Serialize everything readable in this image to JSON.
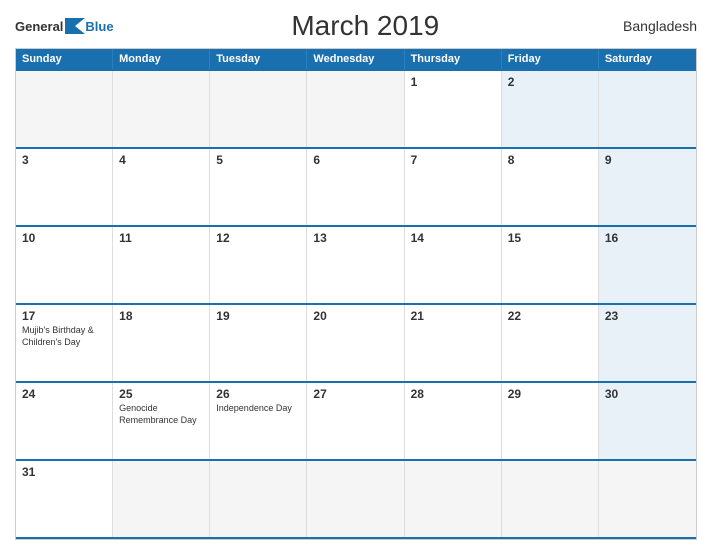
{
  "header": {
    "logo_general": "General",
    "logo_blue": "Blue",
    "title": "March 2019",
    "country": "Bangladesh"
  },
  "calendar": {
    "days_of_week": [
      "Sunday",
      "Monday",
      "Tuesday",
      "Wednesday",
      "Thursday",
      "Friday",
      "Saturday"
    ],
    "weeks": [
      [
        {
          "day": "",
          "empty": true
        },
        {
          "day": "",
          "empty": true
        },
        {
          "day": "",
          "empty": true
        },
        {
          "day": "",
          "empty": true
        },
        {
          "day": "1",
          "event": ""
        },
        {
          "day": "2",
          "event": "",
          "saturday": true
        },
        {
          "day": "",
          "empty": true,
          "hidden": true
        }
      ],
      [
        {
          "day": "3",
          "event": ""
        },
        {
          "day": "4",
          "event": ""
        },
        {
          "day": "5",
          "event": ""
        },
        {
          "day": "6",
          "event": ""
        },
        {
          "day": "7",
          "event": ""
        },
        {
          "day": "8",
          "event": ""
        },
        {
          "day": "9",
          "event": "",
          "saturday": true
        }
      ],
      [
        {
          "day": "10",
          "event": ""
        },
        {
          "day": "11",
          "event": ""
        },
        {
          "day": "12",
          "event": ""
        },
        {
          "day": "13",
          "event": ""
        },
        {
          "day": "14",
          "event": ""
        },
        {
          "day": "15",
          "event": ""
        },
        {
          "day": "16",
          "event": "",
          "saturday": true
        }
      ],
      [
        {
          "day": "17",
          "event": "Mujib's Birthday &\nChildren's Day"
        },
        {
          "day": "18",
          "event": ""
        },
        {
          "day": "19",
          "event": ""
        },
        {
          "day": "20",
          "event": ""
        },
        {
          "day": "21",
          "event": ""
        },
        {
          "day": "22",
          "event": ""
        },
        {
          "day": "23",
          "event": "",
          "saturday": true
        }
      ],
      [
        {
          "day": "24",
          "event": ""
        },
        {
          "day": "25",
          "event": "Genocide\nRemembrance Day"
        },
        {
          "day": "26",
          "event": "Independence Day"
        },
        {
          "day": "27",
          "event": ""
        },
        {
          "day": "28",
          "event": ""
        },
        {
          "day": "29",
          "event": ""
        },
        {
          "day": "30",
          "event": "",
          "saturday": true
        }
      ],
      [
        {
          "day": "31",
          "event": ""
        },
        {
          "day": "",
          "empty": true
        },
        {
          "day": "",
          "empty": true
        },
        {
          "day": "",
          "empty": true
        },
        {
          "day": "",
          "empty": true
        },
        {
          "day": "",
          "empty": true
        },
        {
          "day": "",
          "empty": true,
          "saturday": true
        }
      ]
    ]
  }
}
